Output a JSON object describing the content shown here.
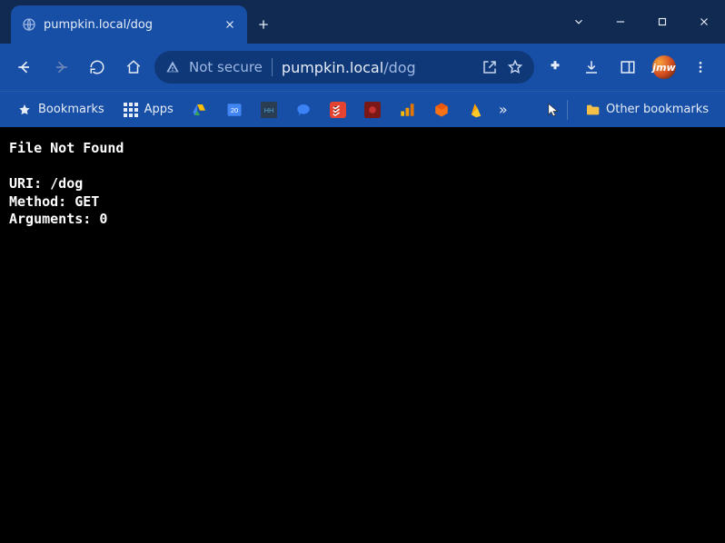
{
  "tab": {
    "title": "pumpkin.local/dog"
  },
  "omnibox": {
    "not_secure": "Not secure",
    "host": "pumpkin.local",
    "path": "/dog"
  },
  "bookmarks": {
    "bookmarks_label": "Bookmarks",
    "apps_label": "Apps",
    "other_label": "Other bookmarks"
  },
  "avatar_text": "jmw",
  "page": {
    "heading": "File Not Found",
    "uri_line": "URI: /dog",
    "method_line": "Method: GET",
    "args_line": "Arguments: 0"
  }
}
